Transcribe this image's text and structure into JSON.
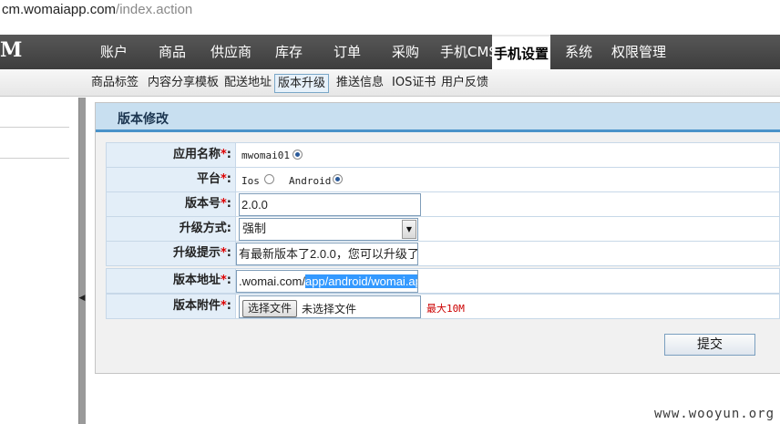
{
  "address_bar": {
    "host": "cm.womaiapp.com",
    "path": "/index.action"
  },
  "logo": "M",
  "top_nav": [
    "账户",
    "商品",
    "供应商",
    "库存",
    "订单",
    "采购",
    "手机CMS",
    "手机设置",
    "系统",
    "权限管理"
  ],
  "top_nav_active": "手机设置",
  "sub_nav": [
    "商品标签",
    "内容分享模板",
    "配送地址",
    "版本升级",
    "推送信息",
    "IOS证书",
    "用户反馈"
  ],
  "sub_nav_active": "版本升级",
  "panel_title": "版本修改",
  "form": {
    "app_name": {
      "label": "应用名称",
      "required": "*",
      "colon": ":",
      "value": "mwomai01"
    },
    "platform": {
      "label": "平台",
      "required": "*",
      "colon": ":",
      "options": [
        "Ios",
        "Android"
      ],
      "selected": "Android"
    },
    "version": {
      "label": "版本号",
      "required": "*",
      "colon": ":",
      "value": "2.0.0"
    },
    "upgrade_mode": {
      "label": "升级方式",
      "colon": ":",
      "value": "强制"
    },
    "upgrade_tip": {
      "label": "升级提示",
      "required": "*",
      "colon": ":",
      "value": "有最新版本了2.0.0，您可以升级了"
    },
    "version_url": {
      "label": "版本地址",
      "required": "*",
      "colon": ":",
      "value_plain": ".womai.com/",
      "value_selected": "app/android/womai.apk"
    },
    "attachment": {
      "label": "版本附件",
      "required": "*",
      "colon": ":",
      "button": "选择文件",
      "no_file": "未选择文件",
      "max_size": "最大10M"
    }
  },
  "submit_label": "提交",
  "watermark": "www.wooyun.org"
}
